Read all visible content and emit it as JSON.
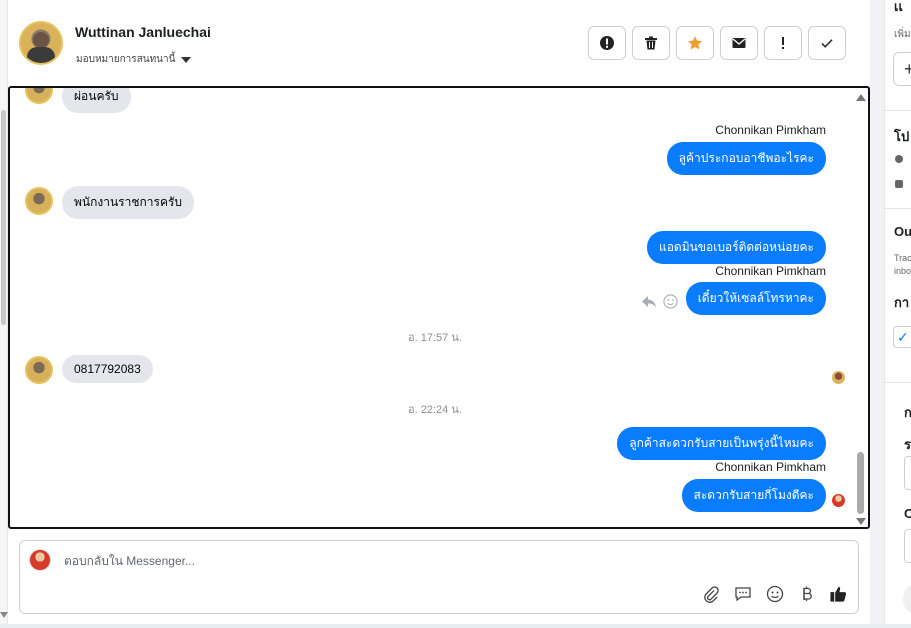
{
  "header": {
    "name": "Wuttinan Janluechai",
    "assign_label": "มอบหมายการสนทนานี้"
  },
  "actions": [
    {
      "name": "report-button",
      "icon": "exclamation-circle-icon"
    },
    {
      "name": "delete-button",
      "icon": "trash-icon"
    },
    {
      "name": "star-button",
      "icon": "star-icon",
      "color": "#f0a030"
    },
    {
      "name": "mail-button",
      "icon": "envelope-icon"
    },
    {
      "name": "flag-button",
      "icon": "exclamation-icon"
    },
    {
      "name": "done-button",
      "icon": "checkmark-icon"
    }
  ],
  "messages": {
    "m0": "ผ่อนครับ",
    "sender1": "Chonnikan Pimkham",
    "m1": "ลูค้าประกอบอาชีพอะไรคะ",
    "m2": "พนักงานราชการครับ",
    "m3": "แอดมินขอเบอร์ติดต่อหน่อยคะ",
    "sender2": "Chonnikan Pimkham",
    "m4": "เดี๋ยวให้เซลล์โทรหาคะ",
    "ts1": "อ. 17:57 น.",
    "m5": "0817792083",
    "ts2": "อ. 22:24 น.",
    "m6": "ลูกค้าสะดวกรับสายเป็นพรุ่งนี้ไหมคะ",
    "sender3": "Chonnikan Pimkham",
    "m7": "สะดวกรับสายกี่โมงดีคะ"
  },
  "composer": {
    "placeholder": "ตอบกลับใน Messenger..."
  },
  "right_panel": {
    "t1": "เเ",
    "s1": "เพิ่ม",
    "t2": "โป",
    "t3": "Ou",
    "s3a": "Trac",
    "s3b": "inbo",
    "t4": "กา",
    "t5": "ก",
    "t6": "ร",
    "t7": "C"
  },
  "colors": {
    "accent": "#0a7cff",
    "incoming": "#e4e6eb",
    "star": "#f0a030"
  }
}
